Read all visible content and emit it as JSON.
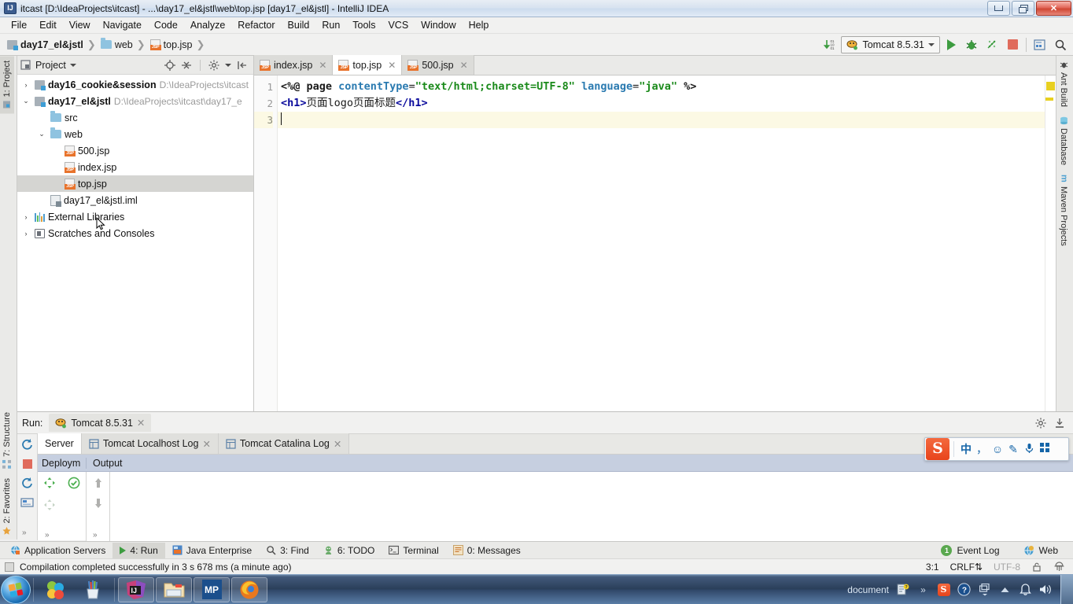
{
  "window": {
    "title": "itcast [D:\\IdeaProjects\\itcast] - ...\\day17_el&jstl\\web\\top.jsp [day17_el&jstl] - IntelliJ IDEA",
    "app_icon": "intellij-idea-icon",
    "minimize": "–",
    "restore": "❐",
    "close": "✕"
  },
  "menu": {
    "items": [
      {
        "label": "File"
      },
      {
        "label": "Edit"
      },
      {
        "label": "View"
      },
      {
        "label": "Navigate"
      },
      {
        "label": "Code"
      },
      {
        "label": "Analyze"
      },
      {
        "label": "Refactor"
      },
      {
        "label": "Build"
      },
      {
        "label": "Run"
      },
      {
        "label": "Tools"
      },
      {
        "label": "VCS"
      },
      {
        "label": "Window"
      },
      {
        "label": "Help"
      }
    ]
  },
  "navbar": {
    "breadcrumbs": [
      {
        "label": "day17_el&jstl",
        "icon": "module-icon"
      },
      {
        "label": "web",
        "icon": "folder-icon"
      },
      {
        "label": "top.jsp",
        "icon": "jsp-file-icon"
      }
    ],
    "separator": "❯",
    "run_config": "Tomcat 8.5.31",
    "run_config_caret": "⌄",
    "actions": [
      "compare-icon",
      "run-icon",
      "debug-icon",
      "run-coverage-icon",
      "stop-icon",
      "app-servers-icon",
      "search-everywhere-icon"
    ]
  },
  "left_strip": {
    "top": [
      {
        "label": "1: Project",
        "active": true
      }
    ],
    "bottom": [
      {
        "label": "7: Structure",
        "active": false
      },
      {
        "label": "2: Favorites",
        "active": false
      }
    ]
  },
  "right_strip": {
    "items": [
      {
        "label": "Ant Build",
        "icon": "ant-icon"
      },
      {
        "label": "Database",
        "icon": "database-icon"
      },
      {
        "label": "Maven Projects",
        "icon": "maven-icon"
      }
    ]
  },
  "project_panel": {
    "title": "Project",
    "title_caret": "▾",
    "actions": [
      "locate-icon",
      "collapse-all-icon",
      "settings-gear-icon",
      "hide-panel-icon"
    ],
    "tree": [
      {
        "arrow": "›",
        "label": "day16_cookie&session",
        "bold": true,
        "path": "D:\\IdeaProjects\\itcast",
        "icon": "module-icon",
        "indent": 0,
        "selected": false
      },
      {
        "arrow": "⌄",
        "label": "day17_el&jstl",
        "bold": true,
        "path": "D:\\IdeaProjects\\itcast\\day17_e",
        "icon": "module-icon",
        "indent": 0,
        "selected": false
      },
      {
        "arrow": "",
        "label": "src",
        "bold": false,
        "path": "",
        "icon": "folder-icon",
        "indent": 1,
        "selected": false
      },
      {
        "arrow": "⌄",
        "label": "web",
        "bold": false,
        "path": "",
        "icon": "folder-icon",
        "indent": 1,
        "selected": false
      },
      {
        "arrow": "",
        "label": "500.jsp",
        "bold": false,
        "path": "",
        "icon": "jsp-file-icon",
        "indent": 2,
        "selected": false
      },
      {
        "arrow": "",
        "label": "index.jsp",
        "bold": false,
        "path": "",
        "icon": "jsp-file-icon",
        "indent": 2,
        "selected": false
      },
      {
        "arrow": "",
        "label": "top.jsp",
        "bold": false,
        "path": "",
        "icon": "jsp-file-icon",
        "indent": 2,
        "selected": true
      },
      {
        "arrow": "",
        "label": "day17_el&jstl.iml",
        "bold": false,
        "path": "",
        "icon": "iml-file-icon",
        "indent": 1,
        "selected": false
      },
      {
        "arrow": "›",
        "label": "External Libraries",
        "bold": false,
        "path": "",
        "icon": "library-icon",
        "indent": 0,
        "selected": false
      },
      {
        "arrow": "›",
        "label": "Scratches and Consoles",
        "bold": false,
        "path": "",
        "icon": "scratches-icon",
        "indent": 0,
        "selected": false
      }
    ]
  },
  "editor": {
    "tabs": [
      {
        "label": "index.jsp",
        "active": false,
        "close": "✕"
      },
      {
        "label": "top.jsp",
        "active": true,
        "close": "✕"
      },
      {
        "label": "500.jsp",
        "active": false,
        "close": "✕"
      }
    ],
    "line_numbers": [
      "1",
      "2",
      "3"
    ],
    "code": {
      "line1": {
        "open": "<%@ page ",
        "attr1": "contentType",
        "eq": "=",
        "val1": "\"text/html;charset=UTF-8\"",
        "attr2": "language",
        "val2": "\"java\"",
        "close": "%>"
      },
      "line2": {
        "tag_open": "<h1>",
        "text": "页面logo页面标题",
        "tag_close": "</h1>"
      },
      "line3": ""
    }
  },
  "run_window": {
    "label": "Run:",
    "config_tab": "Tomcat 8.5.31",
    "config_tab_close": "✕",
    "head_actions": [
      "settings-gear-icon",
      "hide-icon"
    ],
    "sidebar_actions": [
      "rerun-icon",
      "stop-icon",
      "restart-server-icon",
      "threaddump-icon"
    ],
    "tabs": [
      {
        "label": "Server",
        "active": true,
        "close": ""
      },
      {
        "label": "Tomcat Localhost Log",
        "active": false,
        "close": "✕"
      },
      {
        "label": "Tomcat Catalina Log",
        "active": false,
        "close": "✕"
      }
    ],
    "columns": [
      {
        "label": "Deploym"
      },
      {
        "label": "Output"
      }
    ]
  },
  "tool_window_bar": {
    "items": [
      {
        "label": "Application Servers",
        "icon": "app-servers-icon",
        "active": false
      },
      {
        "label": "4: Run",
        "icon": "run-icon",
        "active": true
      },
      {
        "label": "Java Enterprise",
        "icon": "java-ee-icon",
        "active": false
      },
      {
        "label": "3: Find",
        "icon": "find-icon",
        "active": false
      },
      {
        "label": "6: TODO",
        "icon": "todo-icon",
        "active": false
      },
      {
        "label": "Terminal",
        "icon": "terminal-icon",
        "active": false
      },
      {
        "label": "0: Messages",
        "icon": "messages-icon",
        "active": false
      }
    ],
    "right": [
      {
        "label": "Event Log",
        "icon": "event-log-icon",
        "badge": "1"
      },
      {
        "label": "Web",
        "icon": "web-icon",
        "badge": ""
      }
    ]
  },
  "status_bar": {
    "message": "Compilation completed successfully in 3 s 678 ms (a minute ago)",
    "caret_position": "3:1",
    "line_separator": "CRLF",
    "line_separator_caret": "⇅",
    "encoding": "UTF-8",
    "lock_icon": "read-only-lock-icon",
    "inspection_icon": "hector-icon"
  },
  "ime_bar": {
    "logo": "S",
    "items": [
      {
        "icon": "chinese-mode-icon",
        "label": "中"
      },
      {
        "icon": "punctuation-icon",
        "label": "，"
      },
      {
        "icon": "emoji-icon",
        "label": "☺"
      },
      {
        "icon": "pen-icon",
        "label": "✎"
      },
      {
        "icon": "microphone-icon",
        "label": "🎤"
      },
      {
        "icon": "toolbox-icon",
        "label": "▦"
      }
    ]
  },
  "taskbar": {
    "start": "windows-start-orb",
    "quick_launch": [
      "media-player-icon",
      "pencil-cup-icon"
    ],
    "apps": [
      {
        "icon": "intellij-idea-icon",
        "label": "IJ",
        "pinned": true
      },
      {
        "icon": "file-explorer-icon",
        "label": "",
        "pinned": true
      },
      {
        "icon": "mp-app-icon",
        "label": "MP",
        "pinned": true
      },
      {
        "icon": "firefox-icon",
        "label": "",
        "pinned": true
      }
    ],
    "tray_text": "document",
    "tray_icons": [
      "document-help-icon",
      "overflow-icon",
      "sogou-icon",
      "help-icon",
      "window-icon",
      "show-hidden-icon",
      "notifications-bell-icon",
      "volume-icon"
    ]
  },
  "colors": {
    "accent": "#2a7ab0",
    "string_green": "#1a8a1a",
    "tag_blue": "#0a0a9c",
    "selection_gray": "#d5d5d2",
    "current_line": "#fcf9e4",
    "warning_yellow": "#e8d020",
    "sogou_orange": "#e8441c"
  }
}
